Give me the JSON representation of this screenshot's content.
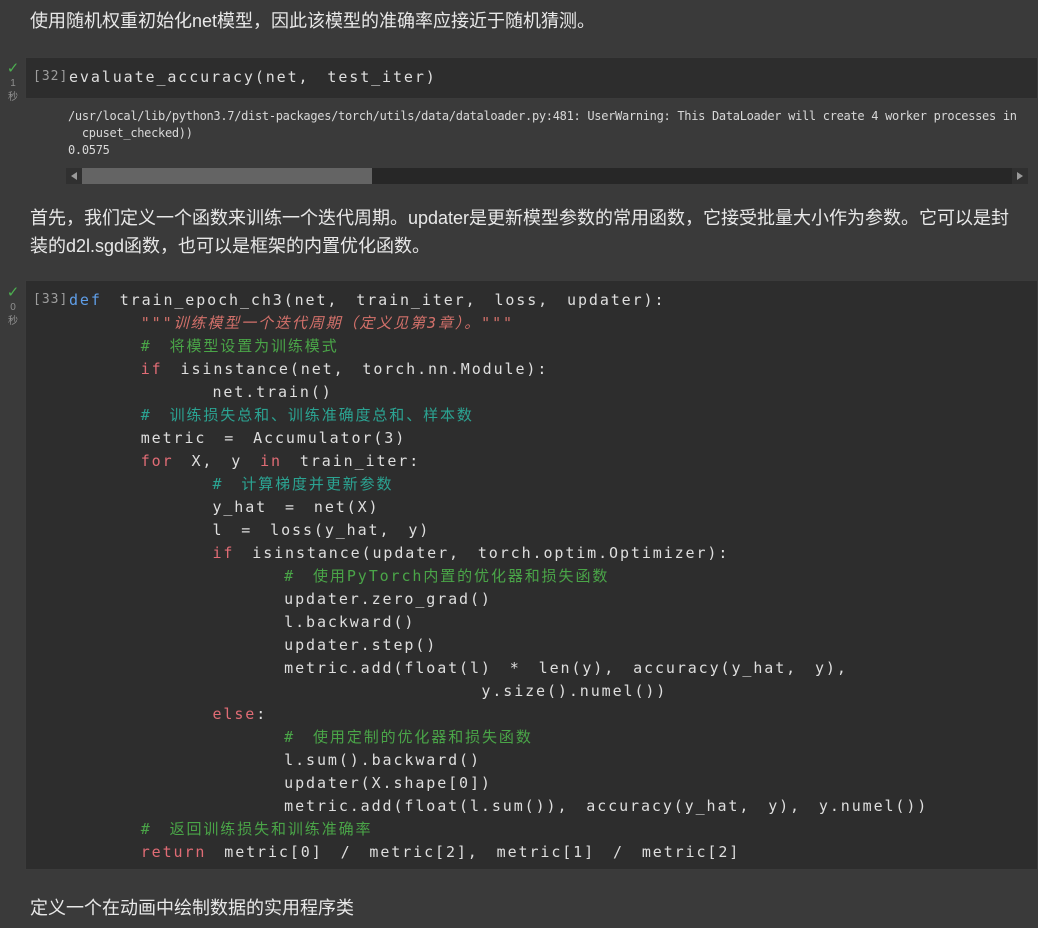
{
  "theme": {
    "page_bg": "#3a3a3a",
    "cell_bg": "#2d2d2d",
    "accent_success": "#4caf50",
    "code_plain": "#dedede",
    "code_keyword": "#e06c75",
    "code_def_keyword": "#5f9ee8",
    "code_string": "#d2706a",
    "code_comment": "#4aa548",
    "code_comment_alt": "#2ba392"
  },
  "icons": {
    "success_check": "✓"
  },
  "markdown_top": "使用随机权重初始化net模型，因此该模型的准确率应接近于随机猜测。",
  "markdown_mid": "首先，我们定义一个函数来训练一个迭代周期。updater是更新模型参数的常用函数，它接受批量大小作为参数。它可以是封装的d2l.sgd函数，也可以是框架的内置优化函数。",
  "markdown_bottom": "定义一个在动画中绘制数据的实用程序类",
  "cells": {
    "c32": {
      "exec_count": "[32]",
      "time_value": "1",
      "time_unit": "秒",
      "code": [
        [
          {
            "t": "evaluate_accuracy(net, test_iter)",
            "c": "pl"
          }
        ]
      ],
      "output_lines": [
        "/usr/local/lib/python3.7/dist-packages/torch/utils/data/dataloader.py:481: UserWarning: This DataLoader will create 4 worker processes in",
        "  cpuset_checked))",
        "0.0575"
      ]
    },
    "c33": {
      "exec_count": "[33]",
      "time_value": "0",
      "time_unit": "秒",
      "code": [
        [
          {
            "t": "def",
            "c": "def"
          },
          {
            "t": " train_epoch_ch3(net, train_iter, loss, updater):",
            "c": "pl"
          }
        ],
        [
          {
            "t": "    ",
            "c": "pl"
          },
          {
            "t": "\"\"\"训练模型一个迭代周期（定义见第3章）。\"\"\"",
            "c": "str"
          }
        ],
        [
          {
            "t": "    ",
            "c": "pl"
          },
          {
            "t": "# 将模型设置为训练模式",
            "c": "cm"
          }
        ],
        [
          {
            "t": "    ",
            "c": "pl"
          },
          {
            "t": "if",
            "c": "kw"
          },
          {
            "t": " isinstance(net, torch.nn.Module):",
            "c": "pl"
          }
        ],
        [
          {
            "t": "        net.train()",
            "c": "pl"
          }
        ],
        [
          {
            "t": "    ",
            "c": "pl"
          },
          {
            "t": "# 训练损失总和、训练准确度总和、样本数",
            "c": "cm2"
          }
        ],
        [
          {
            "t": "    metric = Accumulator(3)",
            "c": "pl"
          }
        ],
        [
          {
            "t": "    ",
            "c": "pl"
          },
          {
            "t": "for",
            "c": "kw"
          },
          {
            "t": " X, y ",
            "c": "pl"
          },
          {
            "t": "in",
            "c": "kw"
          },
          {
            "t": " train_iter:",
            "c": "pl"
          }
        ],
        [
          {
            "t": "        ",
            "c": "pl"
          },
          {
            "t": "# 计算梯度并更新参数",
            "c": "cm2"
          }
        ],
        [
          {
            "t": "        y_hat = net(X)",
            "c": "pl"
          }
        ],
        [
          {
            "t": "        l = loss(y_hat, y)",
            "c": "pl"
          }
        ],
        [
          {
            "t": "        ",
            "c": "pl"
          },
          {
            "t": "if",
            "c": "kw"
          },
          {
            "t": " isinstance(updater, torch.optim.Optimizer):",
            "c": "pl"
          }
        ],
        [
          {
            "t": "            ",
            "c": "pl"
          },
          {
            "t": "# 使用PyTorch内置的优化器和损失函数",
            "c": "cm"
          }
        ],
        [
          {
            "t": "            updater.zero_grad()",
            "c": "pl"
          }
        ],
        [
          {
            "t": "            l.backward()",
            "c": "pl"
          }
        ],
        [
          {
            "t": "            updater.step()",
            "c": "pl"
          }
        ],
        [
          {
            "t": "            metric.add(float(l) * len(y), accuracy(y_hat, y),",
            "c": "pl"
          }
        ],
        [
          {
            "t": "                       y.size().numel())",
            "c": "pl"
          }
        ],
        [
          {
            "t": "        ",
            "c": "pl"
          },
          {
            "t": "else",
            "c": "kw"
          },
          {
            "t": ":",
            "c": "pl"
          }
        ],
        [
          {
            "t": "            ",
            "c": "pl"
          },
          {
            "t": "# 使用定制的优化器和损失函数",
            "c": "cm"
          }
        ],
        [
          {
            "t": "            l.sum().backward()",
            "c": "pl"
          }
        ],
        [
          {
            "t": "            updater(X.shape[0])",
            "c": "pl"
          }
        ],
        [
          {
            "t": "            metric.add(float(l.sum()), accuracy(y_hat, y), y.numel())",
            "c": "pl"
          }
        ],
        [
          {
            "t": "    ",
            "c": "pl"
          },
          {
            "t": "# 返回训练损失和训练准确率",
            "c": "cm"
          }
        ],
        [
          {
            "t": "    ",
            "c": "pl"
          },
          {
            "t": "return",
            "c": "kw"
          },
          {
            "t": " metric[0] / metric[2], metric[1] / metric[2]",
            "c": "pl"
          }
        ]
      ]
    }
  }
}
